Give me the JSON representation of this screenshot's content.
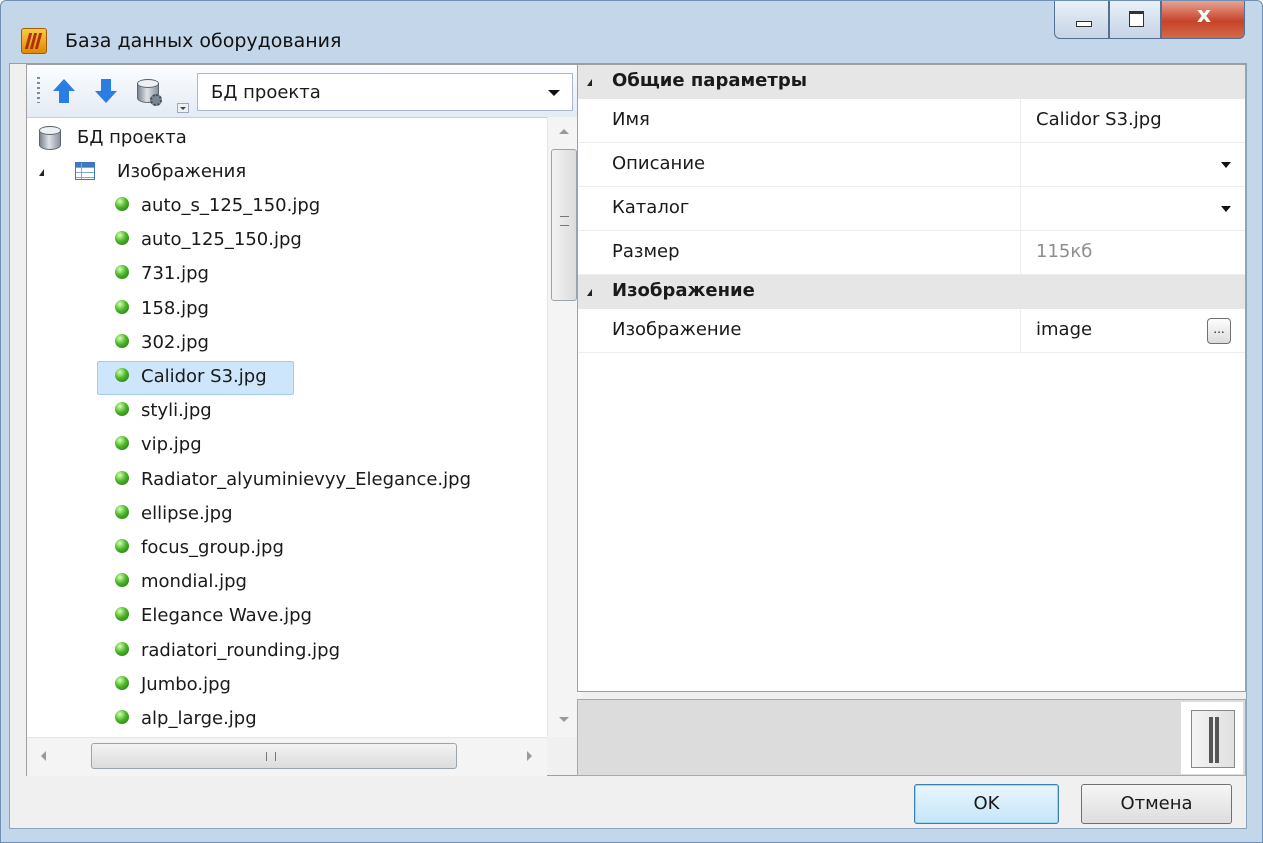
{
  "window": {
    "title": "База данных оборудования",
    "controls": {
      "minimize": "minimize",
      "maximize": "maximize",
      "close": "x"
    }
  },
  "toolbar": {
    "combo_value": "БД проекта"
  },
  "tree": {
    "root_label": "БД проекта",
    "group_label": "Изображения",
    "items": [
      "auto_s_125_150.jpg",
      "auto_125_150.jpg",
      "731.jpg",
      "158.jpg",
      "302.jpg",
      "Calidor S3.jpg",
      "styli.jpg",
      "vip.jpg",
      "Radiator_alyuminievyy_Elegance.jpg",
      "ellipse.jpg",
      "focus_group.jpg",
      "mondial.jpg",
      "Elegance Wave.jpg",
      "radiatori_rounding.jpg",
      "Jumbo.jpg",
      "alp_large.jpg"
    ],
    "selected": "Calidor S3.jpg"
  },
  "properties": {
    "general": {
      "title": "Общие параметры",
      "name_label": "Имя",
      "name_value": "Calidor S3.jpg",
      "description_label": "Описание",
      "description_value": "",
      "catalog_label": "Каталог",
      "catalog_value": "",
      "size_label": "Размер",
      "size_value": "115кб"
    },
    "image": {
      "title": "Изображение",
      "image_label": "Изображение",
      "image_value": "image",
      "browse_label": "..."
    }
  },
  "buttons": {
    "ok": "OK",
    "cancel": "Отмена"
  },
  "icons": {
    "app": "app-radiator-icon",
    "up": "arrow-up-icon",
    "down": "arrow-down-icon",
    "db": "database-icon",
    "table": "table-icon",
    "item": "green-ball-icon"
  },
  "colors": {
    "selection": "#cde6fb",
    "category_bg": "#e6e6e6",
    "window_frame": "#c4d6ea"
  }
}
